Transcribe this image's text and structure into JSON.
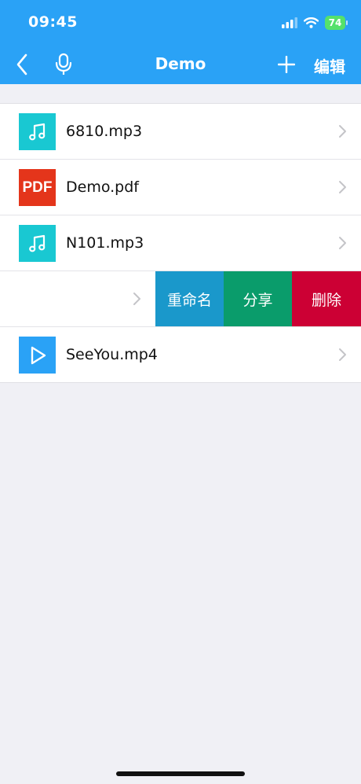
{
  "status": {
    "time": "09:45",
    "battery": "74"
  },
  "nav": {
    "title": "Demo",
    "edit_label": "编辑"
  },
  "files": [
    {
      "name": "6810.mp3",
      "type": "music-icon"
    },
    {
      "name": "Demo.pdf",
      "type": "pdf-icon",
      "icon_text": "PDF"
    },
    {
      "name": "N101.mp3",
      "type": "music-icon"
    },
    {
      "name": "",
      "type": "swiped-row"
    },
    {
      "name": "SeeYou.mp4",
      "type": "video-icon"
    }
  ],
  "swipe_actions": {
    "rename": "重命名",
    "share": "分享",
    "delete": "删除"
  },
  "colors": {
    "header": "#2aa2f6",
    "music": "#19c8d2",
    "pdf": "#e4351b",
    "video": "#2aa2f6",
    "rename": "#1a98cb",
    "share": "#0a9c6b",
    "delete": "#cc0034",
    "background": "#f0f0f5"
  }
}
